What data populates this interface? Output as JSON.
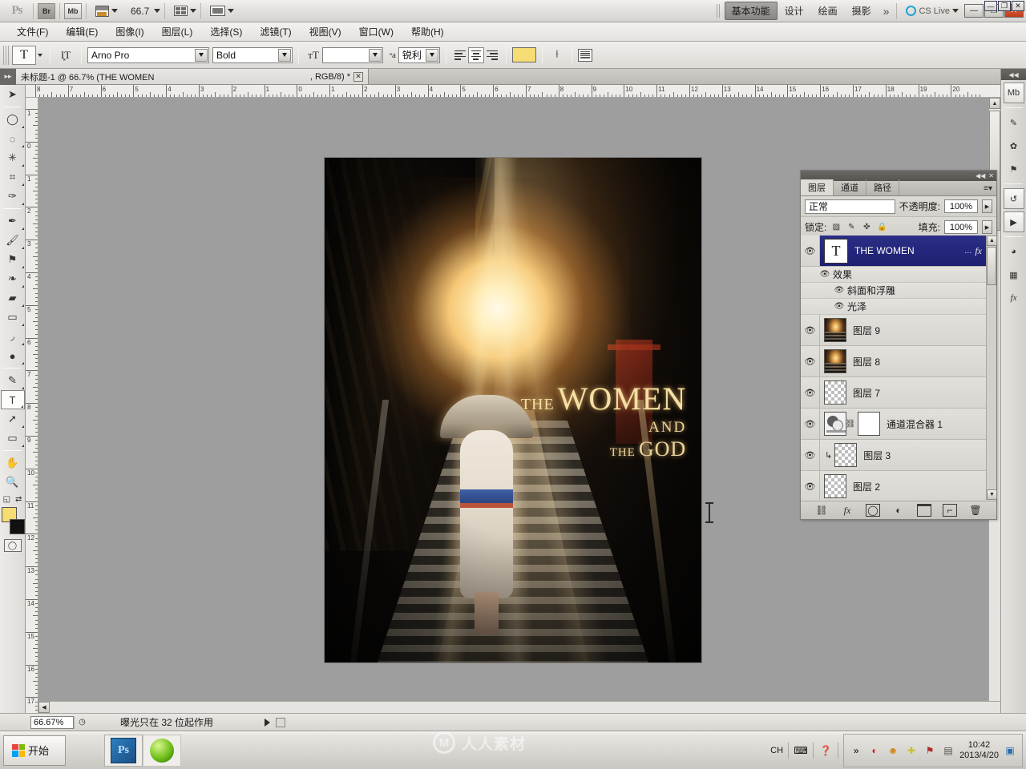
{
  "appbar": {
    "logo": "Ps",
    "bridge_label": "Br",
    "minibridge_label": "Mb",
    "zoom_value": "66.7",
    "icons": [
      "ruler-guides-icon",
      "zoom-dropdown-icon",
      "arrange-documents-icon",
      "screen-mode-icon"
    ],
    "workspaces": [
      {
        "label": "基本功能",
        "selected": true
      },
      {
        "label": "设计",
        "selected": false
      },
      {
        "label": "绘画",
        "selected": false
      },
      {
        "label": "摄影",
        "selected": false
      }
    ],
    "more_label": "»",
    "cslive_label": "CS Live",
    "window_buttons": [
      "—",
      "❐",
      "✕"
    ],
    "mini_window_buttons": [
      "—",
      "❐",
      "✕"
    ]
  },
  "menubar": {
    "items": [
      "文件(F)",
      "编辑(E)",
      "图像(I)",
      "图层(L)",
      "选择(S)",
      "滤镜(T)",
      "视图(V)",
      "窗口(W)",
      "帮助(H)"
    ]
  },
  "optionsbar": {
    "active_tool_glyph": "T",
    "orientation_icon": "text-orientation-icon",
    "font_family": "Arno Pro",
    "font_style": "Bold",
    "size_icon": "font-size-icon",
    "font_size": "",
    "antialias_icon": "anti-alias-icon",
    "antialias_value": "锐利",
    "align": [
      "align-left-icon",
      "align-center-icon",
      "align-right-icon"
    ],
    "align_selected_index": 1,
    "text_color": "#f5dc73",
    "warp_icon": "warp-text-icon",
    "panels_icon": "character-paragraph-panels-icon"
  },
  "document": {
    "tab_title": "未标题-1 @ 66.7% (THE WOMEN",
    "tab_mode": ", RGB/8) *",
    "close_glyph": "✕"
  },
  "toolbar": {
    "tools": [
      {
        "name": "move-tool",
        "glyph": "➤",
        "selected": false,
        "flyout": false
      },
      {
        "name": "marquee-tool",
        "glyph": "◯",
        "selected": false,
        "flyout": true
      },
      {
        "name": "lasso-tool",
        "glyph": "◌",
        "selected": false,
        "flyout": true
      },
      {
        "name": "quick-selection-tool",
        "glyph": "✳",
        "selected": false,
        "flyout": true
      },
      {
        "name": "crop-tool",
        "glyph": "⌗",
        "selected": false,
        "flyout": true
      },
      {
        "name": "eyedropper-tool",
        "glyph": "✑",
        "selected": false,
        "flyout": true
      },
      {
        "name": "healing-brush-tool",
        "glyph": "✒",
        "selected": false,
        "flyout": true
      },
      {
        "name": "brush-tool",
        "glyph": "🖌",
        "selected": false,
        "flyout": true
      },
      {
        "name": "clone-stamp-tool",
        "glyph": "⚑",
        "selected": false,
        "flyout": true
      },
      {
        "name": "history-brush-tool",
        "glyph": "❧",
        "selected": false,
        "flyout": true
      },
      {
        "name": "eraser-tool",
        "glyph": "▰",
        "selected": false,
        "flyout": true
      },
      {
        "name": "gradient-tool",
        "glyph": "▭",
        "selected": false,
        "flyout": true
      },
      {
        "name": "blur-tool",
        "glyph": "◞",
        "selected": false,
        "flyout": true
      },
      {
        "name": "dodge-tool",
        "glyph": "●",
        "selected": false,
        "flyout": true
      },
      {
        "name": "pen-tool",
        "glyph": "✎",
        "selected": false,
        "flyout": true
      },
      {
        "name": "type-tool",
        "glyph": "T",
        "selected": true,
        "flyout": true
      },
      {
        "name": "path-selection-tool",
        "glyph": "➚",
        "selected": false,
        "flyout": true
      },
      {
        "name": "rectangle-shape-tool",
        "glyph": "▭",
        "selected": false,
        "flyout": true
      },
      {
        "name": "hand-tool",
        "glyph": "✋",
        "selected": false,
        "flyout": false
      },
      {
        "name": "zoom-tool",
        "glyph": "🔍",
        "selected": false,
        "flyout": false
      }
    ],
    "default-colors-icon": "default-colors-icon",
    "swap-colors-icon": "swap-colors-icon",
    "foreground_color": "#f5dc73",
    "background_color": "#111111",
    "quickmask_icon": "quick-mask-icon"
  },
  "rulers": {
    "horizontal_ticks": [
      "8",
      "7",
      "6",
      "5",
      "4",
      "3",
      "2",
      "1",
      "0",
      "1",
      "2",
      "3",
      "4",
      "5",
      "6",
      "7",
      "8",
      "9",
      "10",
      "11",
      "12",
      "13",
      "14",
      "15",
      "16",
      "17",
      "18",
      "19",
      "20"
    ],
    "vertical_ticks": [
      "1",
      "0",
      "1",
      "2",
      "3",
      "4",
      "5",
      "6",
      "7",
      "8",
      "9",
      "10",
      "11",
      "12",
      "13",
      "14",
      "15",
      "16",
      "17"
    ]
  },
  "canvas": {
    "artwork_title_the": "THE",
    "artwork_title_women": "WOMEN",
    "artwork_title_and": "AND",
    "artwork_title_the2": "THE",
    "artwork_title_god": "GOD"
  },
  "layers_panel": {
    "tabs": [
      {
        "label": "图层",
        "selected": true
      },
      {
        "label": "通道",
        "selected": false
      },
      {
        "label": "路径",
        "selected": false
      }
    ],
    "menu_icon": "panel-menu-icon",
    "collapse_icon": "collapse-panel-icon",
    "close_icon": "close-panel-icon",
    "blend_mode": "正常",
    "opacity_label": "不透明度:",
    "opacity_value": "100%",
    "lock_label": "锁定:",
    "lock_icons": [
      "lock-transparency-icon",
      "lock-image-icon",
      "lock-position-icon",
      "lock-all-icon"
    ],
    "fill_label": "填充:",
    "fill_value": "100%",
    "layers": [
      {
        "name": "THE WOMEN",
        "type": "text",
        "selected": true,
        "visible": true,
        "dots": "...",
        "fx": "fx"
      },
      {
        "name": "效果",
        "type": "effects-header",
        "visible": true
      },
      {
        "name": "斜面和浮雕",
        "type": "effect",
        "visible": true
      },
      {
        "name": "光泽",
        "type": "effect",
        "visible": true
      },
      {
        "name": "图层 9",
        "type": "photo",
        "selected": false,
        "visible": true
      },
      {
        "name": "图层 8",
        "type": "photo",
        "selected": false,
        "visible": true
      },
      {
        "name": "图层 7",
        "type": "empty",
        "selected": false,
        "visible": true
      },
      {
        "name": "通道混合器 1",
        "type": "adjustment",
        "selected": false,
        "visible": true
      },
      {
        "name": "图层 3",
        "type": "clipped",
        "selected": false,
        "visible": true
      },
      {
        "name": "图层 2",
        "type": "empty",
        "selected": false,
        "visible": true
      }
    ],
    "footer_icons": [
      "link-layers-icon",
      "add-layer-style-icon",
      "add-layer-mask-icon",
      "new-adjustment-layer-icon",
      "new-group-icon",
      "new-layer-icon",
      "delete-layer-icon"
    ]
  },
  "right_dock": {
    "collapse_glyph": "◀◀",
    "icons": [
      {
        "name": "mini-bridge-icon",
        "glyph": "Mb"
      },
      {
        "name": "brush-presets-icon",
        "glyph": "✎"
      },
      {
        "name": "brush-panel-icon",
        "glyph": "✿"
      },
      {
        "name": "clone-source-icon",
        "glyph": "⚑"
      },
      {
        "name": "history-icon",
        "glyph": "↺"
      },
      {
        "name": "actions-icon",
        "glyph": "▶"
      },
      {
        "name": "color-icon",
        "glyph": "◕"
      },
      {
        "name": "swatches-icon",
        "glyph": "▦"
      },
      {
        "name": "styles-icon",
        "glyph": "fx"
      }
    ]
  },
  "statusbar": {
    "zoom_value": "66.67%",
    "doc-info-icon": "document-info-icon",
    "message": "曝光只在 32 位起作用",
    "arrow_glyph": "▶"
  },
  "taskbar": {
    "start_label": "开始",
    "apps": [
      {
        "name": "photoshop-taskbar-button",
        "glyph": "Ps"
      },
      {
        "name": "green-app-taskbar-button",
        "glyph": ""
      }
    ],
    "tray": {
      "ime_label": "CH",
      "keyboard_icon": "keyboard-icon",
      "help_icon": "help-icon",
      "expand_icon": "show-hidden-icons-icon",
      "icons": [
        "red-moon-icon",
        "qq-icon",
        "security-shield-icon",
        "flag-icon",
        "tablet-icon"
      ],
      "time": "10:42",
      "date": "2013/4/20",
      "show-desktop-icon": "show-desktop-icon"
    }
  },
  "watermark": {
    "text": "人人素材",
    "mark": "M"
  }
}
